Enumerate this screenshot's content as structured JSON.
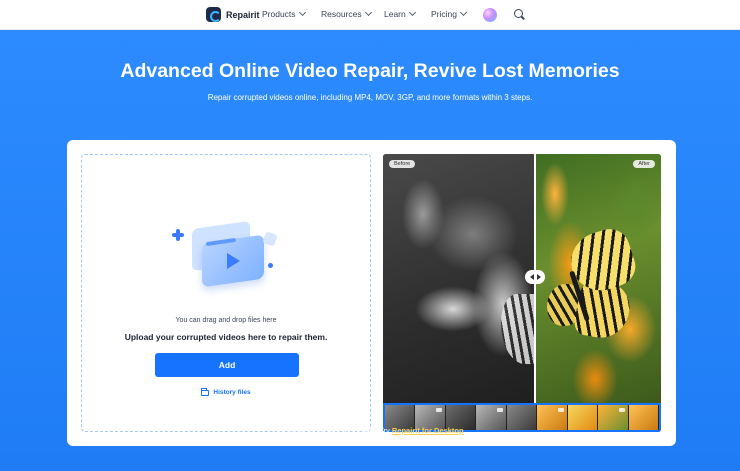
{
  "nav": {
    "logo_text": "Repairit",
    "items": [
      "Products",
      "Resources",
      "Learn",
      "Pricing"
    ]
  },
  "hero": {
    "title": "Advanced Online Video Repair, Revive Lost Memories",
    "subtitle": "Repair corrupted videos online, including MP4, MOV, 3GP, and more formats within 3 steps."
  },
  "upload": {
    "drag_hint": "You can drag and drop files here",
    "heading": "Upload your corrupted videos here to repair them.",
    "add_label": "Add",
    "history_label": "History files"
  },
  "compare": {
    "before_label": "Before",
    "after_label": "After"
  },
  "footer": {
    "prefix": "Prefer to repair videos locally? Try ",
    "link": "Repairit for Desktop"
  },
  "colors": {
    "hero_bg": "#2d8bff",
    "primary_button": "#1673ff",
    "footer_link": "#ffcf4a"
  },
  "icons": [
    "repairit-logo-icon",
    "chevron-down-icon",
    "ai-assistant-icon",
    "search-icon",
    "folder-icon",
    "slider-handle-icon"
  ]
}
